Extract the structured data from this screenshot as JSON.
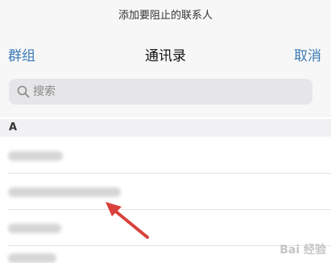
{
  "prompt_bar": {
    "text": "添加要阻止的联系人"
  },
  "nav": {
    "left_label": "群组",
    "title": "通讯录",
    "right_label": "取消"
  },
  "search": {
    "placeholder": "搜索"
  },
  "sections": [
    {
      "letter": "A"
    }
  ],
  "colors": {
    "link": "#3c7bb7",
    "background_bar": "#f7f7f7"
  },
  "watermark": {
    "text": "Bai 经验"
  }
}
